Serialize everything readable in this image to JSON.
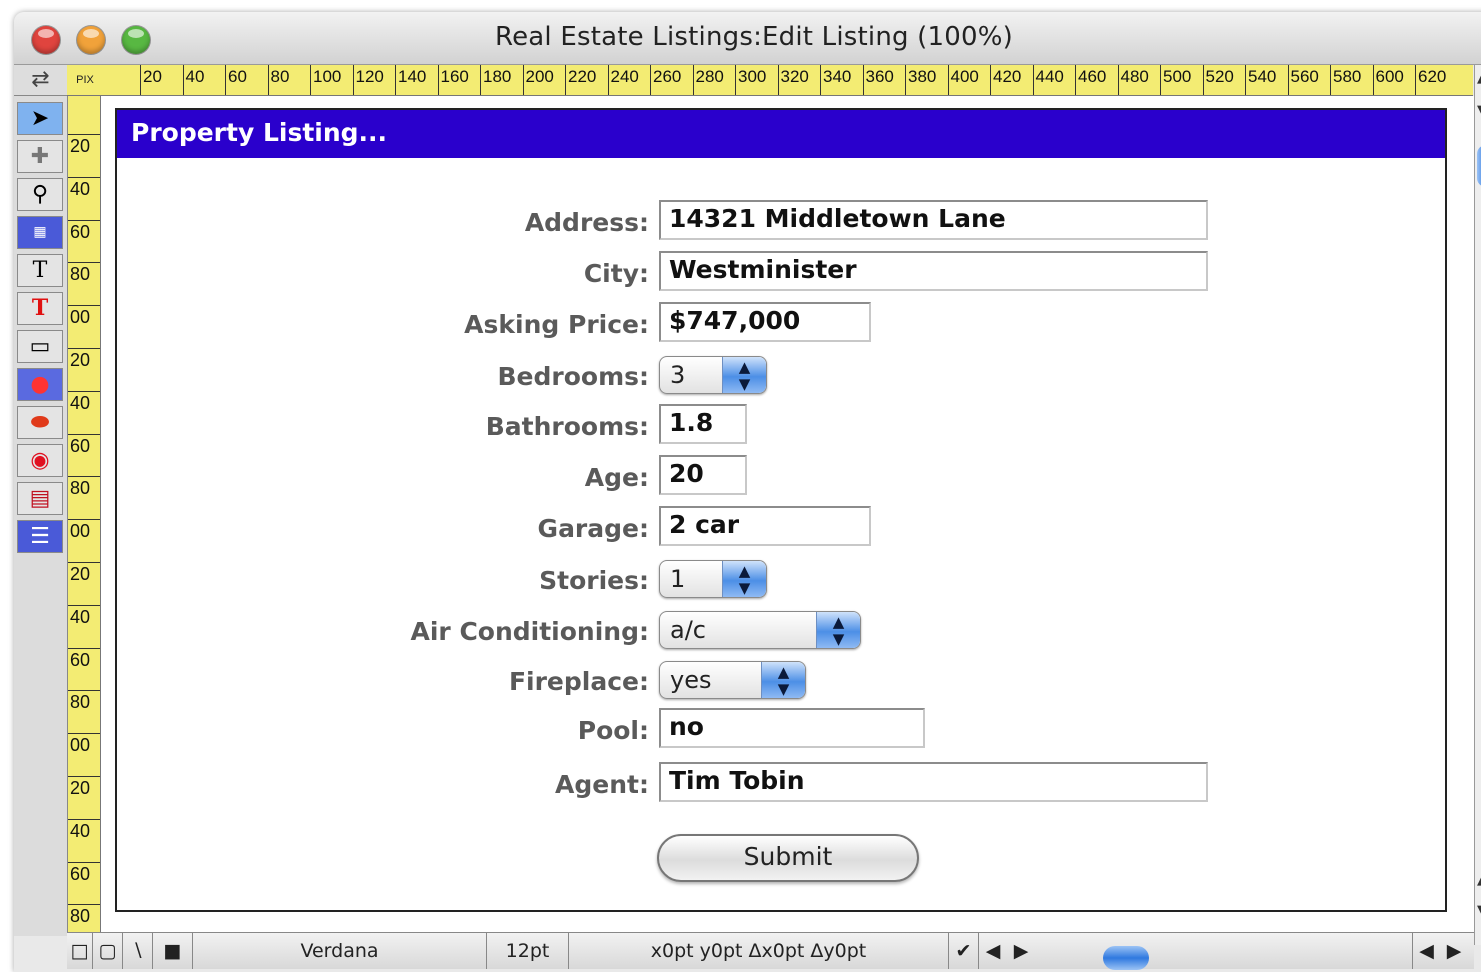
{
  "window": {
    "title": "Real Estate Listings:Edit Listing (100%)",
    "traffic_colors": [
      "#e0443e",
      "#f1a23a",
      "#58b842"
    ]
  },
  "ruler": {
    "unit": "PIX",
    "h_labels": [
      "20",
      "40",
      "60",
      "80",
      "100",
      "120",
      "140",
      "160",
      "180",
      "200",
      "220",
      "240",
      "260",
      "280",
      "300",
      "320",
      "340",
      "360",
      "380",
      "400",
      "420",
      "440",
      "460",
      "480",
      "500",
      "520",
      "540",
      "560",
      "580",
      "600",
      "620"
    ],
    "v_labels": [
      "20",
      "40",
      "60",
      "80",
      "00",
      "20",
      "40",
      "60",
      "80",
      "00",
      "20",
      "40",
      "60",
      "80",
      "00",
      "20",
      "40",
      "60",
      "80"
    ]
  },
  "tools": [
    "pointer-tool",
    "crosshair-tool",
    "zoom-tool",
    "data-cell-tool",
    "text-tool",
    "text-display-tool",
    "rectangle-tool",
    "flash-art-tool",
    "push-button-tool",
    "radio-button-tool",
    "popup-menu-tool",
    "list-tool"
  ],
  "form": {
    "header": "Property Listing...",
    "fields": {
      "address": {
        "label": "Address:",
        "value": "14321 Middletown Lane"
      },
      "city": {
        "label": "City:",
        "value": "Westminister"
      },
      "asking_price": {
        "label": "Asking Price:",
        "value": "$747,000"
      },
      "bedrooms": {
        "label": "Bedrooms:",
        "value": "3"
      },
      "bathrooms": {
        "label": "Bathrooms:",
        "value": "1.8"
      },
      "age": {
        "label": "Age:",
        "value": "20"
      },
      "garage": {
        "label": "Garage:",
        "value": "2 car"
      },
      "stories": {
        "label": "Stories:",
        "value": "1"
      },
      "air_conditioning": {
        "label": "Air Conditioning:",
        "value": "a/c"
      },
      "fireplace": {
        "label": "Fireplace:",
        "value": "yes"
      },
      "pool": {
        "label": "Pool:",
        "value": "no"
      },
      "agent": {
        "label": "Agent:",
        "value": "Tim Tobin"
      }
    },
    "submit_label": "Submit",
    "header_color": "#2a00cc"
  },
  "statusbar": {
    "font": "Verdana",
    "size": "12pt",
    "coords": "x0pt y0pt Δx0pt Δy0pt",
    "check": "✔"
  }
}
